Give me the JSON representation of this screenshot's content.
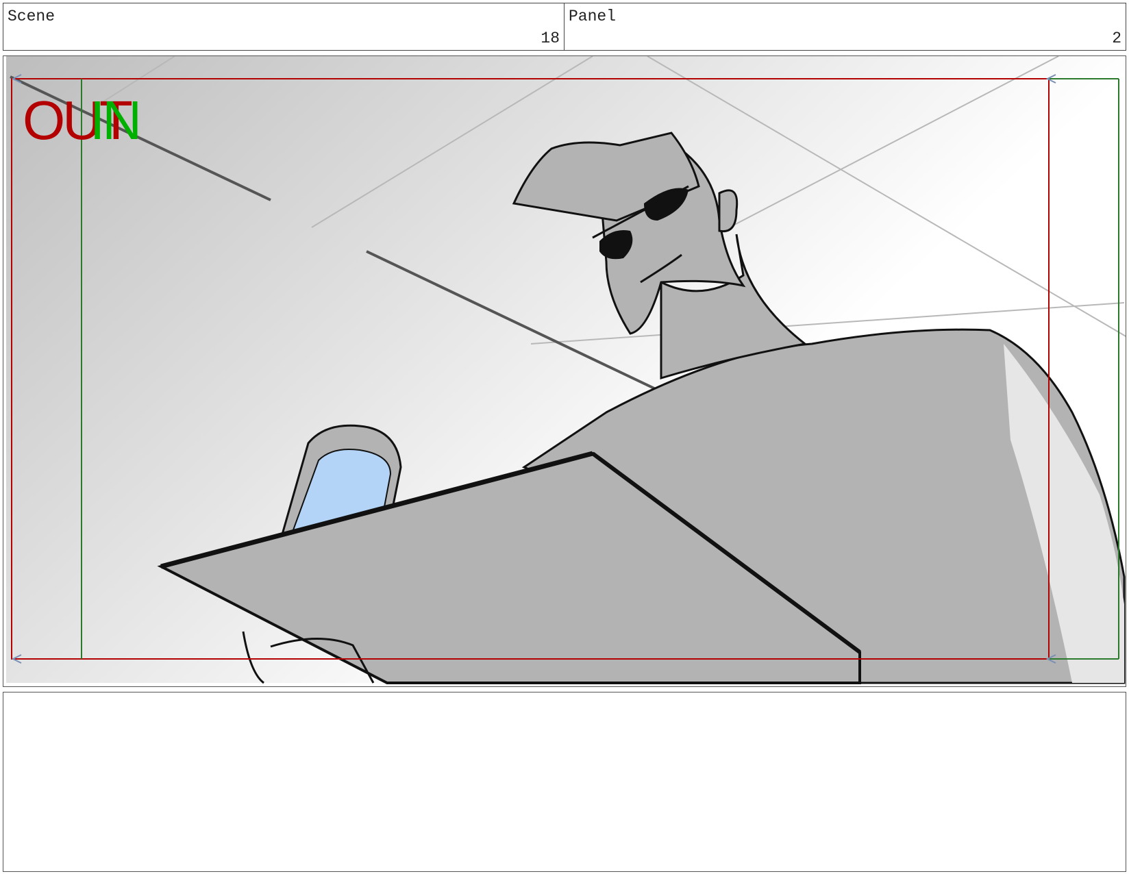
{
  "header": {
    "scene_label": "Scene",
    "scene_number": "18",
    "panel_label": "Panel",
    "panel_number": "2"
  },
  "frame": {
    "out_tag": "OUT",
    "in_tag": "IN",
    "out_color": "#b30000",
    "in_color": "#00b000",
    "phone_screen_color": "#b3d4f7"
  },
  "notes": {
    "text": ""
  }
}
